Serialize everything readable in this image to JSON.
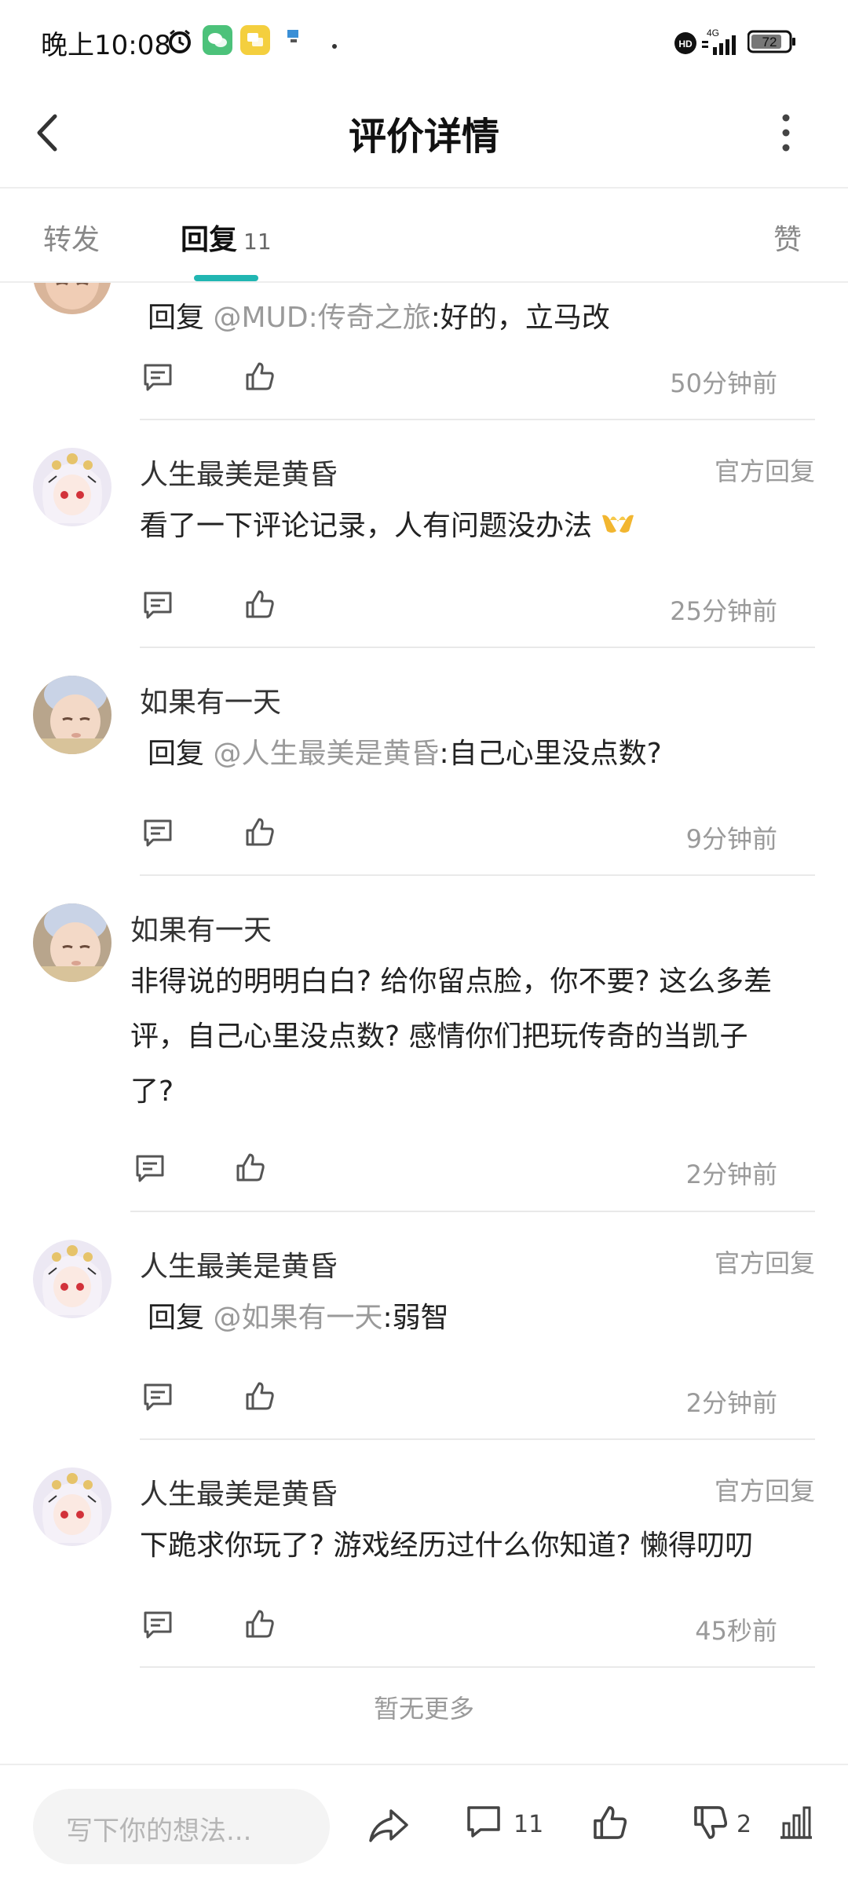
{
  "status_bar": {
    "time": "晚上10:08",
    "network": "4G",
    "battery": "72",
    "icons": [
      "alarm-icon",
      "wechat-icon",
      "chat-app-icon",
      "notification-icon",
      "hd-icon",
      "signal-icon",
      "battery-icon"
    ]
  },
  "header": {
    "title": "评价详情"
  },
  "tabs": {
    "forward": "转发",
    "reply": "回复",
    "reply_count": "11",
    "like": "赞"
  },
  "comments": [
    {
      "reply_prefix": "回复",
      "mention": "@MUD:传奇之旅",
      "body": ":好的，立马改",
      "time": "50分钟前"
    },
    {
      "name": "人生最美是黄昏",
      "badge": "官方回复",
      "text": "看了一下评论记录，人有问题没办法",
      "time": "25分钟前"
    },
    {
      "name": "如果有一天",
      "reply_prefix": "回复",
      "mention": "@人生最美是黄昏",
      "body": ":自己心里没点数?",
      "time": "9分钟前"
    },
    {
      "name": "如果有一天",
      "line1": "非得说的明明白白? 给你留点脸，你不要? 这么多差",
      "line2": "评，自己心里没点数? 感情你们把玩传奇的当凯子",
      "line3": "了?",
      "time": "2分钟前"
    },
    {
      "name": "人生最美是黄昏",
      "badge": "官方回复",
      "reply_prefix": "回复",
      "mention": "@如果有一天",
      "body": ":弱智",
      "time": "2分钟前"
    },
    {
      "name": "人生最美是黄昏",
      "badge": "官方回复",
      "text": "下跪求你玩了? 游戏经历过什么你知道? 懒得叨叨",
      "time": "45秒前"
    }
  ],
  "no_more": "暂无更多",
  "bottom_bar": {
    "placeholder": "写下你的想法...",
    "comment_count": "11",
    "dislike_count": "2"
  },
  "colors": {
    "accent": "#21b6b2",
    "muted_text": "#9a9a9a"
  }
}
